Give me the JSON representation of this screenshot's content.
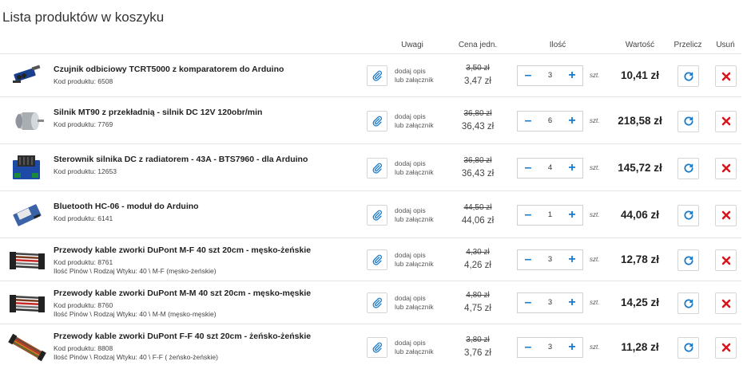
{
  "page": {
    "title": "Lista produktów w koszyku"
  },
  "headers": {
    "notes": "Uwagi",
    "unit_price": "Cena jedn.",
    "quantity": "Ilość",
    "value": "Wartość",
    "recalc": "Przelicz",
    "remove": "Usuń"
  },
  "labels": {
    "note_line1": "dodaj opis",
    "note_line2": "lub załącznik",
    "unit": "szt."
  },
  "colors": {
    "accent": "#1779c9",
    "remove": "#d9141a"
  },
  "items": [
    {
      "name": "Czujnik odbiciowy TCRT5000 z komparatorem do Arduino",
      "code": "Kod produktu: 6508",
      "extra": "",
      "old_price": "3,50 zł",
      "price": "3,47 zł",
      "qty": "3",
      "value": "10,41 zł",
      "icon": "sensor-module"
    },
    {
      "name": "Silnik MT90 z przekładnią - silnik DC 12V 120obr/min",
      "code": "Kod produktu: 7769",
      "extra": "",
      "old_price": "36,80 zł",
      "price": "36,43 zł",
      "qty": "6",
      "value": "218,58 zł",
      "icon": "dc-motor"
    },
    {
      "name": "Sterownik silnika DC z radiatorem - 43A - BTS7960 - dla Arduino",
      "code": "Kod produktu: 12653",
      "extra": "",
      "old_price": "36,80 zł",
      "price": "36,43 zł",
      "qty": "4",
      "value": "145,72 zł",
      "icon": "motor-driver"
    },
    {
      "name": "Bluetooth HC-06 - moduł do Arduino",
      "code": "Kod produktu: 6141",
      "extra": "",
      "old_price": "44,50 zł",
      "price": "44,06 zł",
      "qty": "1",
      "value": "44,06 zł",
      "icon": "bluetooth-module"
    },
    {
      "name": "Przewody kable zworki DuPont M-F 40 szt 20cm - męsko-żeńskie",
      "code": "Kod produktu: 8761",
      "extra": "Ilość Pinów \\ Rodzaj Wtyku: 40 \\ M-F (męsko-żeńskie)",
      "old_price": "4,30 zł",
      "price": "4,26 zł",
      "qty": "3",
      "value": "12,78 zł",
      "icon": "jumper-wires"
    },
    {
      "name": "Przewody kable zworki DuPont M-M 40 szt 20cm - męsko-męskie",
      "code": "Kod produktu: 8760",
      "extra": "Ilość Pinów \\ Rodzaj Wtyku: 40 \\ M-M (męsko-męskie)",
      "old_price": "4,80 zł",
      "price": "4,75 zł",
      "qty": "3",
      "value": "14,25 zł",
      "icon": "jumper-wires"
    },
    {
      "name": "Przewody kable zworki DuPont F-F 40 szt 20cm - żeńsko-żeńskie",
      "code": "Kod produktu: 8808",
      "extra": "Ilość Pinów \\ Rodzaj Wtyku: 40 \\ F-F ( żeńsko-żeńskie)",
      "old_price": "3,80 zł",
      "price": "3,76 zł",
      "qty": "3",
      "value": "11,28 zł",
      "icon": "ribbon-cable"
    }
  ]
}
